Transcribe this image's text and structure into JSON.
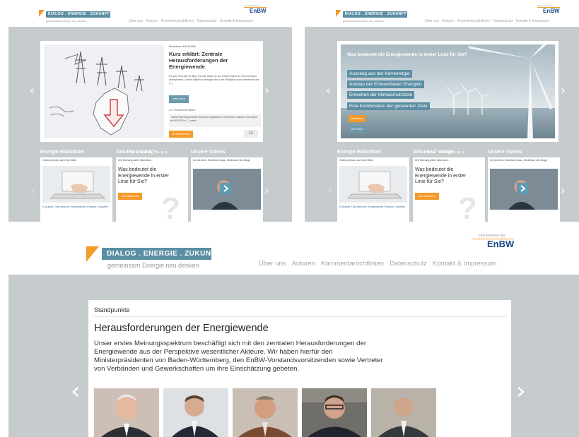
{
  "logo": {
    "title": "DIALOG . ENERGIE . ZUKUNFT",
    "tagline": "gemeinsam Energie neu denken"
  },
  "enbw": {
    "initiative": "eine Initiative der",
    "brand": "EnBW"
  },
  "nav": [
    "Über uns",
    "Autoren",
    "Kommentarrichtlinien",
    "Datenschutz",
    "Kontakt & Impressum"
  ],
  "panel1": {
    "author": "Redakteur Kai EnBW",
    "title": "Kurz erklärt: Zentrale Herausforderungen der Energiewende",
    "body": "Es geht heut hier im Blog. Gerade haben an der letzten Marke an Kommentaren überschritten. Gerne! Natürlich verfolgen wir in der Redaktion auch interessiert die (...)",
    "more_button": "mehr lesen",
    "comment_meta": "vor 7 Monat Dirk Halser:",
    "comment_text": "\"Jahrzehnte lang wurden Gewinne eingefahren und Steuern kassiert und davon ist NICHTS in (...) mehr!",
    "all_comments": "Alle Kommentare",
    "comment_count": "12"
  },
  "panel2": {
    "question": "Was bedeutet die Energiewende in erster Linie für Sie?",
    "options": [
      "Ausstieg aus der Kernenergie",
      "Ausbau der Erneuerbaren Energien",
      "Erreichen der Klimaschutzziele",
      "Eine Kombination der genannten Ziele"
    ],
    "vote_button": "Abstimmen",
    "more_button": "mehr lesen"
  },
  "sections": {
    "library": "Energie-Bibliothek",
    "poll": "Aktuelle Umfrage",
    "videos": "Unsere Videos",
    "library_sub": "Online-Literatur auf einen Blick",
    "library_caption": "E analyse: Das deutsche Energiewende-Paradox: Ursachen",
    "poll_sub": "Ihre Meinung zählt. Jetzt abst...",
    "poll_question": "Was bedeutet die Energiewende in erster Linie für Sie?",
    "poll_button": "Jetzt abstimmen",
    "video_sub": "Im Interview: Hubertus Grass - Moderator des Blogs"
  },
  "panel3": {
    "kicker": "Standpunkte",
    "title": "Herausforderungen der Energiewende",
    "body": "Unser erstes Meinungsspektrum beschäftigt sich mit den zentralen Herausforderungen der Energiewende aus der Perspektive wesentlicher Akteure. Wir haben hierfür den Ministerpräsidenten von Baden-Württemberg, den EnBW-Vorstandsvorsitzenden sowie Vertreter von Verbänden und Gewerkschaften um ihre Einschätzung gebeten."
  },
  "colors": {
    "accent": "#f39a28",
    "brand": "#5b8ea3",
    "stage": "#c6ccce"
  },
  "icons": {
    "prev": "chevron-left-icon",
    "next": "chevron-right-icon",
    "play": "play-icon"
  }
}
